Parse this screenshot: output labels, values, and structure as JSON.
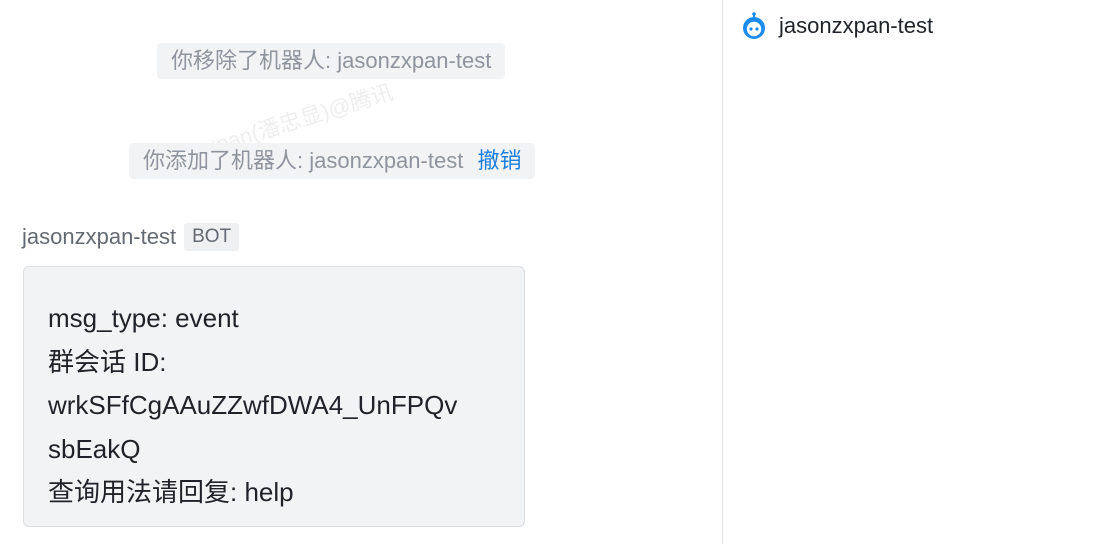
{
  "system_messages": {
    "removed": "你移除了机器人: jasonzxpan-test",
    "added": "你添加了机器人: jasonzxpan-test",
    "undo_label": "撤销"
  },
  "watermark": "jasonzxpan(潘忠显)@腾讯",
  "message": {
    "sender": "jasonzxpan-test",
    "badge": "BOT",
    "lines": [
      "msg_type: event",
      "群会话 ID:",
      "wrkSFfCgAAuZZwfDWA4_UnFPQv",
      "sbEakQ",
      "查询用法请回复: help"
    ]
  },
  "sidebar": {
    "bot_name": "jasonzxpan-test",
    "bot_icon": "robot-icon"
  },
  "colors": {
    "link": "#1a7fe0",
    "bubble_bg": "#f2f3f5",
    "bot_icon": "#1a8cf0"
  }
}
